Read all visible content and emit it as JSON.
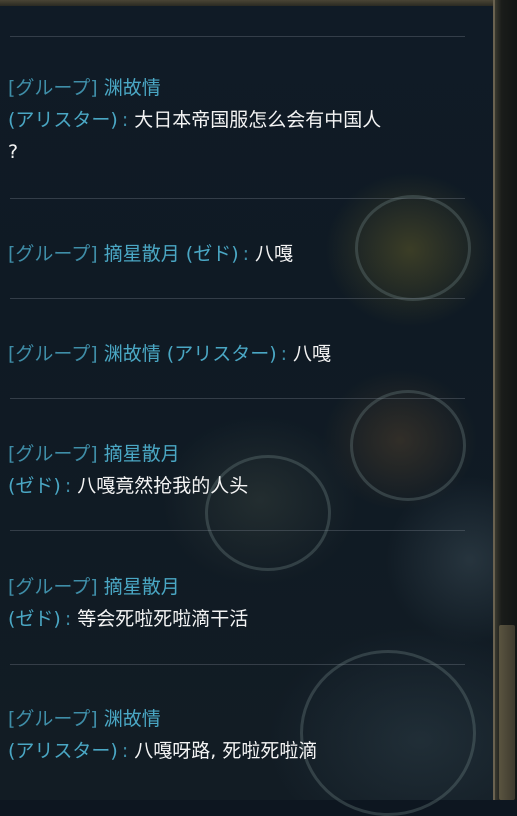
{
  "chat": {
    "messages": [
      {
        "channel": "[グループ]",
        "sender": "渊故情",
        "role": "(アリスター)",
        "separator": ":",
        "text_lines": [
          "大日本帝国服怎么会有中国人",
          "?"
        ]
      },
      {
        "channel": "[グループ]",
        "sender": "摘星散月",
        "role": "(ゼド)",
        "separator": ":",
        "text_lines": [
          "八嘎"
        ]
      },
      {
        "channel": "[グループ]",
        "sender": "渊故情",
        "role": "(アリスター)",
        "separator": ":",
        "text_lines": [
          "八嘎"
        ]
      },
      {
        "channel": "[グループ]",
        "sender": "摘星散月",
        "role": "(ゼド)",
        "separator": ":",
        "text_lines": [
          "八嘎竟然抢我的人头"
        ]
      },
      {
        "channel": "[グループ]",
        "sender": "摘星散月",
        "role": "(ゼド)",
        "separator": ":",
        "text_lines": [
          "等会死啦死啦滴干活"
        ]
      },
      {
        "channel": "[グループ]",
        "sender": "渊故情",
        "role": "(アリスター)",
        "separator": ":",
        "text_lines": [
          "八嘎呀路, 死啦死啦滴"
        ]
      }
    ]
  },
  "colors": {
    "channel": "#3f8ea8",
    "sender": "#4aa7c4",
    "message_text": "#f4f4f4",
    "background": "#0d1620"
  }
}
